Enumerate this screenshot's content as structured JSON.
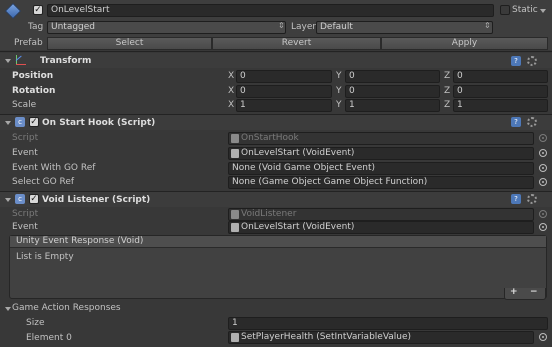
{
  "go": {
    "name": "OnLevelStart",
    "static_label": "Static",
    "tag_label": "Tag",
    "tag_value": "Untagged",
    "layer_label": "Layer",
    "layer_value": "Default",
    "prefab_label": "Prefab",
    "prefab_buttons": [
      "Select",
      "Revert",
      "Apply"
    ]
  },
  "transform": {
    "title": "Transform",
    "rows": [
      {
        "label": "Position",
        "x": "0",
        "y": "0",
        "z": "0"
      },
      {
        "label": "Rotation",
        "x": "0",
        "y": "0",
        "z": "0"
      },
      {
        "label": "Scale",
        "x": "1",
        "y": "1",
        "z": "1"
      }
    ],
    "axis": [
      "X",
      "Y",
      "Z"
    ]
  },
  "on_start": {
    "title": "On Start Hook (Script)",
    "script_label": "Script",
    "script_value": "OnStartHook",
    "event_label": "Event",
    "event_value": "OnLevelStart (VoidEvent)",
    "event_go_label": "Event With GO Ref",
    "event_go_value": "None (Void Game Object Event)",
    "select_go_label": "Select GO Ref",
    "select_go_value": "None (Game Object Game Object Function)"
  },
  "void_listener": {
    "title": "Void Listener (Script)",
    "script_label": "Script",
    "script_value": "VoidListener",
    "event_label": "Event",
    "event_value": "OnLevelStart (VoidEvent)",
    "response_title": "Unity Event Response (Void)",
    "list_empty": "List is Empty",
    "plus": "+",
    "minus": "−",
    "gar_label": "Game Action Responses",
    "size_label": "Size",
    "size_value": "1",
    "element_label": "Element 0",
    "element_value": "SetPlayerHealth (SetIntVariableValue)"
  }
}
